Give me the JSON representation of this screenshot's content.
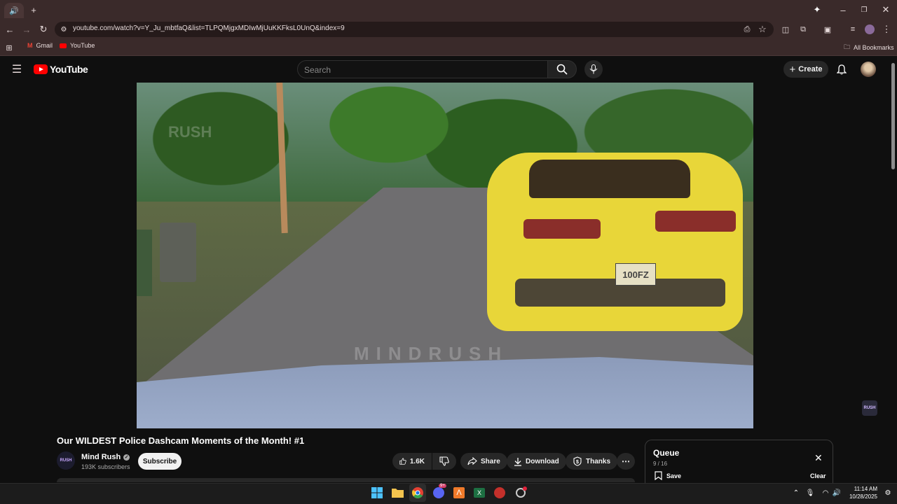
{
  "browser": {
    "url": "youtube.com/watch?v=Y_Ju_mbtfaQ&list=TLPQMjgxMDIwMjUuKKFksL0UnQ&index=9",
    "bookmarks": [
      {
        "label": "Gmail"
      },
      {
        "label": "YouTube"
      }
    ],
    "all_bookmarks": "All Bookmarks"
  },
  "header": {
    "brand": "YouTube",
    "search_placeholder": "Search",
    "create_label": "Create"
  },
  "video": {
    "plate": "100FZ",
    "watermark_center": "MINDRUSH",
    "watermark_corner": "RUSH",
    "channel_watermark": "RUSH"
  },
  "details": {
    "title": "Our WILDEST Police Dashcam Moments of the Month! #1",
    "channel_name": "Mind Rush",
    "channel_avatar": "RUSH",
    "subscribers": "193K subscribers",
    "subscribe": "Subscribe",
    "likes": "1.6K",
    "share": "Share",
    "download": "Download",
    "thanks": "Thanks"
  },
  "queue": {
    "title": "Queue",
    "count": "9 / 16",
    "save": "Save",
    "clear": "Clear"
  },
  "taskbar": {
    "time": "11:14 AM",
    "date": "10/28/2025",
    "badge": "9+"
  },
  "colors": {
    "chrome_bg": "#3a2a2a",
    "yt_bg": "#0f0f0f",
    "yt_red": "#ff0000"
  }
}
